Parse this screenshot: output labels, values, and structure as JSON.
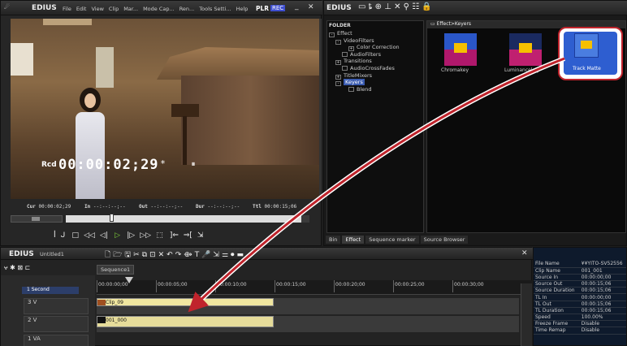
{
  "player": {
    "app": "EDIUS",
    "menu": [
      "File",
      "Edit",
      "View",
      "Clip",
      "Mar...",
      "Mode Cap...",
      "Ren...",
      "Tools Setti...",
      "Help"
    ],
    "mode_plr": "PLR",
    "mode_rec": "REC",
    "rec_label": "Rcd",
    "timecode": "00:00:02;29",
    "tc_mark": "*",
    "pause": "⏸",
    "cur_label": "Cur",
    "cur": "00:00:02;29",
    "in_label": "In",
    "in": "--:--:--;--",
    "out_label": "Out",
    "out": "--:--:--;--",
    "dur_label": "Dur",
    "dur": "--:--:--;--",
    "ttl_label": "Ttl",
    "ttl": "00:00:15;06"
  },
  "effects": {
    "app": "EDIUS",
    "folder_header": "FOLDER",
    "path": "Effect>Keyers",
    "tree": [
      "Effect",
      "VideoFilters",
      "Color Correction",
      "AudioFilters",
      "Transitions",
      "AudioCrossFades",
      "TitleMixers",
      "Keyers",
      "Blend"
    ],
    "items": [
      {
        "label": "Chromakey"
      },
      {
        "label": "Luminancekey"
      },
      {
        "label": "Track Matte"
      }
    ],
    "tabs": [
      "Bin",
      "Effect",
      "Sequence marker",
      "Source Browser"
    ]
  },
  "timeline": {
    "app": "EDIUS",
    "project": "Untitled1",
    "sequence": "Sequence1",
    "scale": "1 Second",
    "ruler": [
      "00:00:00;00",
      "00:00:05;00",
      "00:00:10;00",
      "00:00:15;00",
      "00:00:20;00",
      "00:00:25;00",
      "00:00:30;00"
    ],
    "tracks": [
      {
        "name": "3 V"
      },
      {
        "name": "2 V"
      },
      {
        "name": "1 VA"
      }
    ],
    "clips": [
      {
        "label": "Clip_09"
      },
      {
        "label": "001_000"
      }
    ]
  },
  "info": {
    "rows": [
      [
        "File Name",
        "¥¥YITO-SV52556"
      ],
      [
        "Clip Name",
        "001_001"
      ],
      [
        "Source In",
        "00:00:00;00"
      ],
      [
        "Source Out",
        "00:00:15;06"
      ],
      [
        "Source Duration",
        "00:00:15;06"
      ],
      [
        "TL In",
        "00:00:00;00"
      ],
      [
        "TL Out",
        "00:00:15;06"
      ],
      [
        "TL Duration",
        "00:00:15;06"
      ],
      [
        "Speed",
        "100.00%"
      ],
      [
        "Freeze Frame",
        "Disable"
      ],
      [
        "Time Remap",
        "Disable"
      ]
    ]
  }
}
